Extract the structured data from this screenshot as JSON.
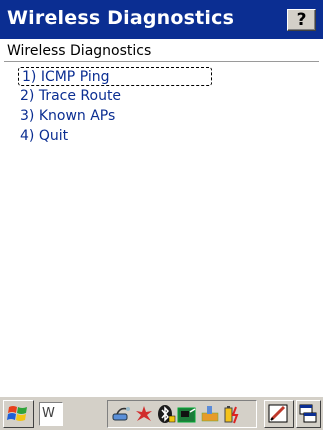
{
  "window": {
    "title": "Wireless Diagnostics",
    "help_label": "?"
  },
  "app": {
    "header": "Wireless Diagnostics"
  },
  "menu": {
    "items": [
      {
        "label": "1) ICMP Ping",
        "focused": true
      },
      {
        "label": "2) Trace Route",
        "focused": false
      },
      {
        "label": "3) Known APs",
        "focused": false
      },
      {
        "label": "4) Quit",
        "focused": false
      }
    ]
  },
  "taskbar": {
    "input_value": "W",
    "icons": [
      "start-icon",
      "network-icon",
      "signal-icon",
      "bluetooth-icon",
      "wireless-card-icon",
      "dock-icon",
      "battery-icon",
      "sip-keyboard-icon",
      "switch-window-icon"
    ]
  },
  "colors": {
    "titlebar": "#0b2e92",
    "menu_text": "#0b2e92",
    "taskbar": "#d4d0c8"
  }
}
